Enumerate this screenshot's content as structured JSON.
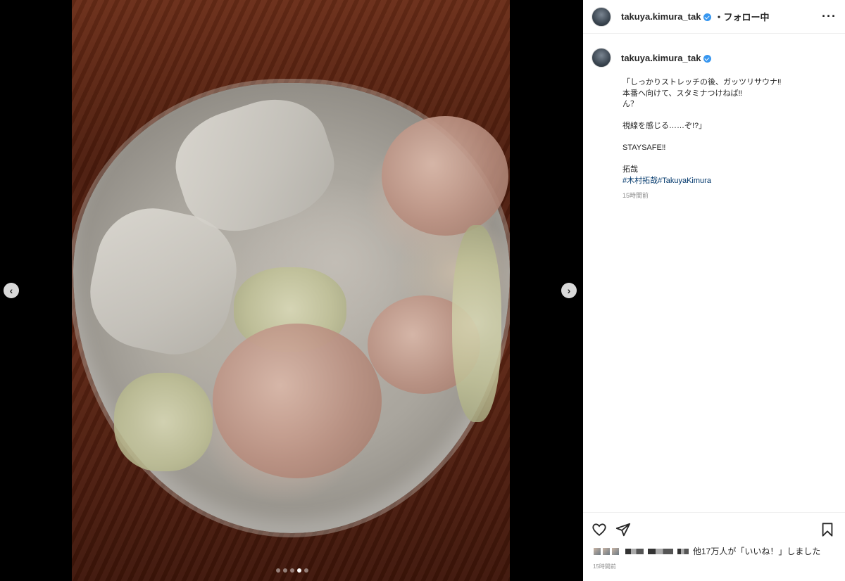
{
  "media": {
    "prev_label": "‹",
    "next_label": "›",
    "dots_count": 5,
    "active_dot": 3
  },
  "header": {
    "username": "takuya.kimura_tak",
    "separator": "・",
    "follow_label": "フォロー中",
    "more_label": "···"
  },
  "caption": {
    "username": "takuya.kimura_tak",
    "text": "「しっかりストレッチの後、ガッツリサウナ‼\n本番へ向けて、スタミナつけねば‼\nん？\n\n視線を感じる……ぞ!?」\n\nSTAYSAFE‼\n\n拓哉",
    "hashtag1": "#木村拓哉",
    "hashtag2": "#TakuyaKimura",
    "time": "15時間前"
  },
  "actions": {
    "likes_suffix": "他17万人が「いいね！」しました",
    "post_time": "15時間前"
  },
  "colors": {
    "link": "#00376b",
    "verified": "#3897f0",
    "muted": "#8e8e8e"
  }
}
